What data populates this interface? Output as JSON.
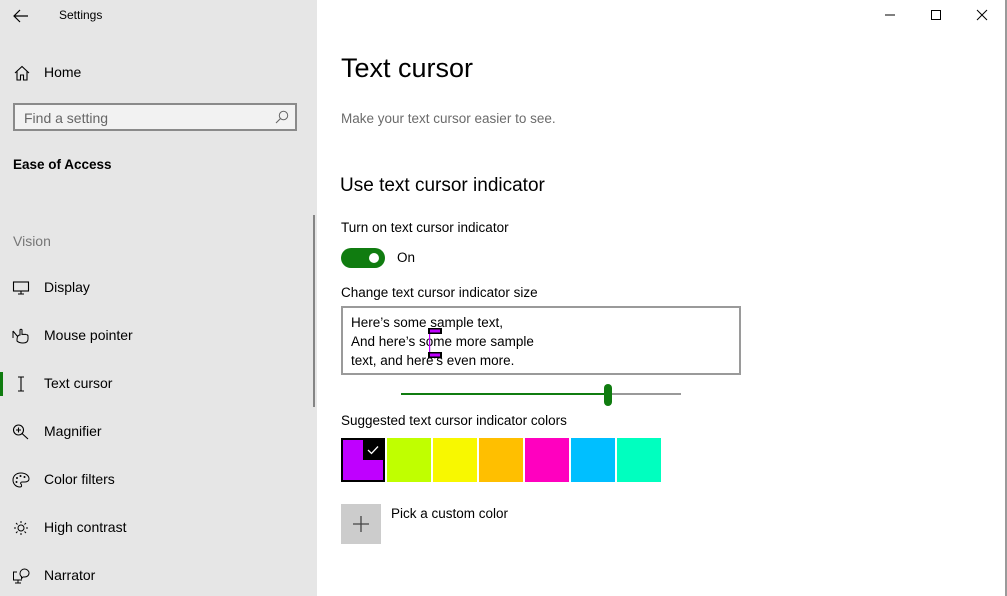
{
  "window": {
    "app_title": "Settings",
    "controls": {
      "minimize": "minimize-icon",
      "maximize": "maximize-icon",
      "close": "close-icon"
    }
  },
  "sidebar": {
    "back_icon": "arrow-left-icon",
    "home": {
      "label": "Home",
      "icon": "home-icon"
    },
    "search": {
      "placeholder": "Find a setting",
      "value": "",
      "icon": "search-icon"
    },
    "section_title": "Ease of Access",
    "group_label": "Vision",
    "items": [
      {
        "label": "Display",
        "icon": "monitor-icon",
        "active": false
      },
      {
        "label": "Mouse pointer",
        "icon": "hand-pointer-icon",
        "active": false
      },
      {
        "label": "Text cursor",
        "icon": "text-cursor-icon",
        "active": true
      },
      {
        "label": "Magnifier",
        "icon": "magnifier-icon",
        "active": false
      },
      {
        "label": "Color filters",
        "icon": "palette-icon",
        "active": false
      },
      {
        "label": "High contrast",
        "icon": "sun-icon",
        "active": false
      },
      {
        "label": "Narrator",
        "icon": "narrator-icon",
        "active": false
      }
    ]
  },
  "main": {
    "title": "Text cursor",
    "description": "Make your text cursor easier to see.",
    "section_title": "Use text cursor indicator",
    "toggle": {
      "label": "Turn on text cursor indicator",
      "state_label": "On",
      "on": true
    },
    "size": {
      "label": "Change text cursor indicator size",
      "preview_lines": [
        "Here’s some sample text,",
        "And here’s some more sample",
        "text, and here’s even more."
      ],
      "slider_fraction": 0.74
    },
    "colors": {
      "label": "Suggested text cursor indicator colors",
      "swatches": [
        {
          "color": "#bf00ff",
          "selected": true
        },
        {
          "color": "#c0ff00",
          "selected": false
        },
        {
          "color": "#f8f800",
          "selected": false
        },
        {
          "color": "#ffbf00",
          "selected": false
        },
        {
          "color": "#ff00bf",
          "selected": false
        },
        {
          "color": "#00bfff",
          "selected": false
        },
        {
          "color": "#00ffbf",
          "selected": false
        }
      ],
      "custom_label": "Pick a custom color",
      "custom_icon": "plus-icon"
    },
    "accent_color": "#107c10"
  }
}
